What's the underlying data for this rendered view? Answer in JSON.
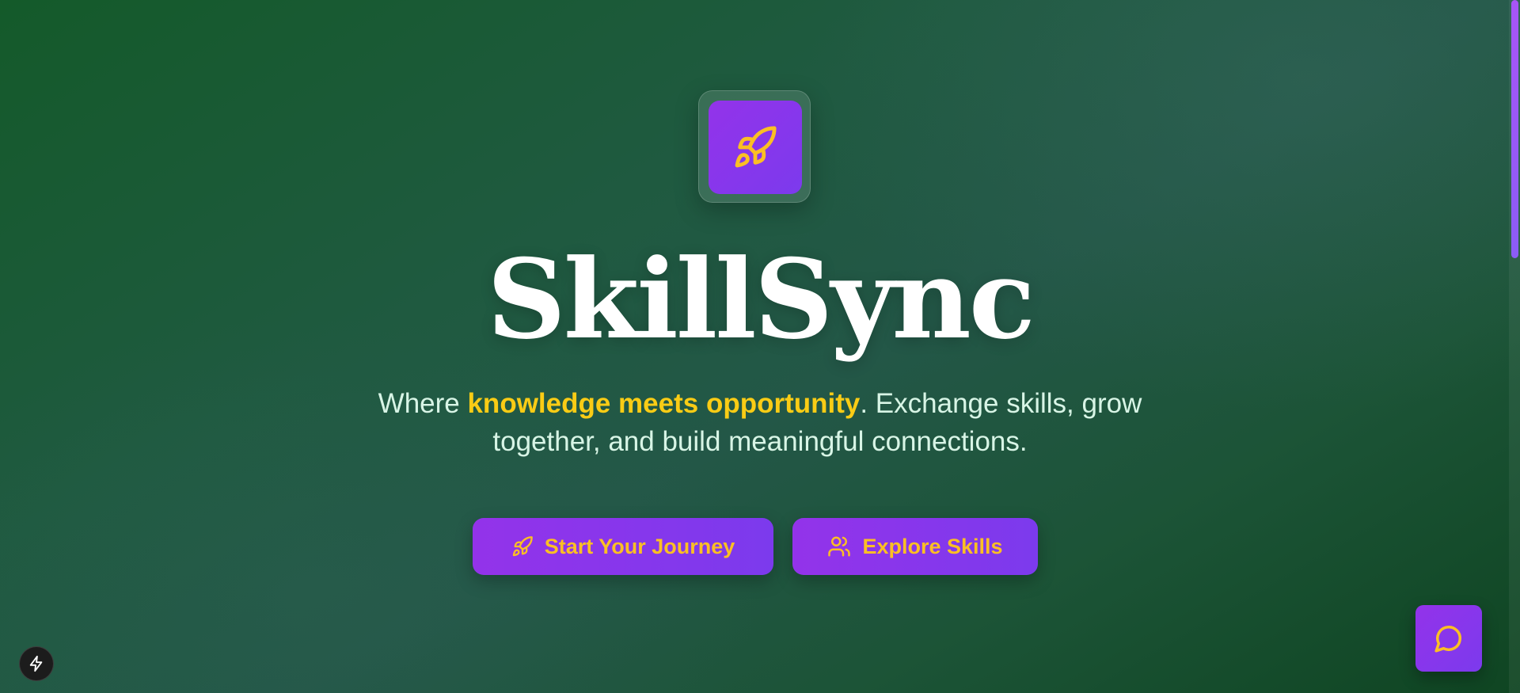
{
  "app": {
    "title": "SkillSync"
  },
  "hero": {
    "logo_icon": "rocket-icon",
    "subtitle_prefix": "Where ",
    "subtitle_highlight": "knowledge meets opportunity",
    "subtitle_suffix": ". Exchange skills, grow together, and build meaningful connections."
  },
  "actions": {
    "start_label": "Start Your Journey",
    "start_icon": "rocket-icon",
    "explore_label": "Explore Skills",
    "explore_icon": "users-icon"
  },
  "floating": {
    "chat_icon": "chat-bubble-icon",
    "bolt_icon": "lightning-bolt-icon"
  },
  "colors": {
    "accent_purple": "#9333ea",
    "accent_violet": "#7c3aed",
    "highlight_yellow": "#facc15",
    "button_text": "#fbbf24",
    "background_green": "#1f5a40"
  }
}
